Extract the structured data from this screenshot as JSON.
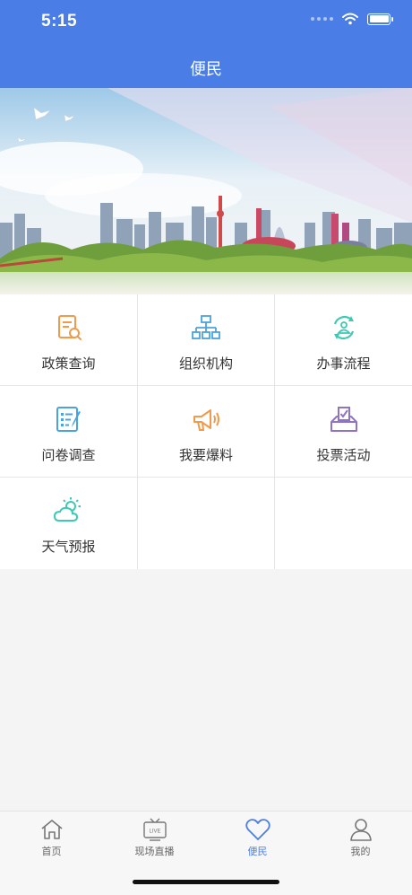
{
  "status_bar": {
    "time": "5:15"
  },
  "header": {
    "title": "便民"
  },
  "colors": {
    "brand_blue": "#4a7ee6",
    "icon_orange": "#f29a4a",
    "icon_blue": "#4aa3df",
    "icon_teal": "#3ec9b4",
    "icon_purple": "#8d74c9"
  },
  "grid": {
    "items": [
      {
        "label": "政策查询",
        "icon": "policy-search-icon"
      },
      {
        "label": "组织机构",
        "icon": "org-chart-icon"
      },
      {
        "label": "办事流程",
        "icon": "process-cycle-icon"
      },
      {
        "label": "问卷调查",
        "icon": "questionnaire-icon"
      },
      {
        "label": "我要爆料",
        "icon": "megaphone-icon"
      },
      {
        "label": "投票活动",
        "icon": "ballot-box-icon"
      },
      {
        "label": "天气预报",
        "icon": "weather-icon"
      }
    ]
  },
  "tabbar": {
    "tabs": [
      {
        "label": "首页",
        "icon": "home-icon"
      },
      {
        "label": "现场直播",
        "icon": "live-tv-icon",
        "badge": "LIVE"
      },
      {
        "label": "便民",
        "icon": "heart-icon",
        "active": true
      },
      {
        "label": "我的",
        "icon": "user-icon"
      }
    ]
  }
}
